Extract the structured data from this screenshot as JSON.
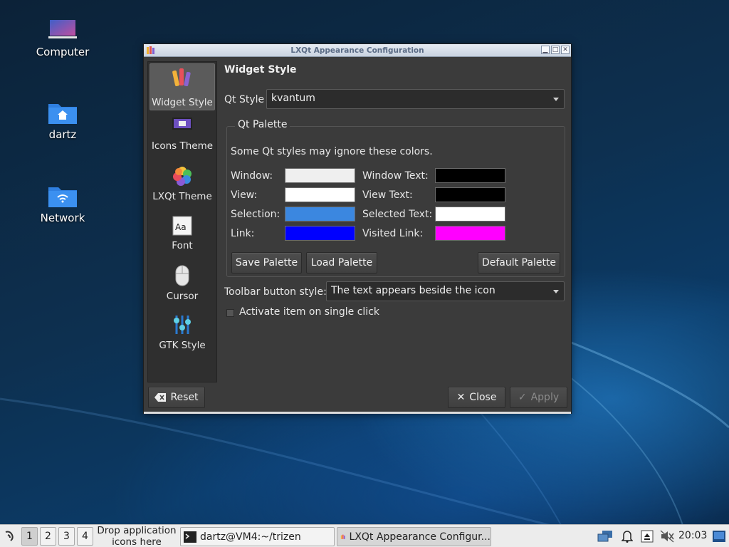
{
  "desktop": {
    "icons": [
      {
        "label": "Computer"
      },
      {
        "label": "dartz"
      },
      {
        "label": "Network"
      }
    ]
  },
  "window": {
    "title": "LXQt Appearance Configuration",
    "sidebar": {
      "items": [
        {
          "label": "Widget Style",
          "icon": "widget-style-icon",
          "active": true
        },
        {
          "label": "Icons Theme",
          "icon": "icons-theme-icon"
        },
        {
          "label": "LXQt Theme",
          "icon": "lxqt-theme-icon"
        },
        {
          "label": "Font",
          "icon": "font-icon"
        },
        {
          "label": "Cursor",
          "icon": "cursor-icon"
        },
        {
          "label": "GTK Style",
          "icon": "gtk-style-icon"
        }
      ]
    },
    "page": {
      "heading": "Widget Style",
      "qt_style_label": "Qt Style",
      "qt_style_value": "kvantum",
      "palette": {
        "group_title": "Qt Palette",
        "note": "Some Qt styles may ignore these colors.",
        "rows": [
          {
            "left_label": "Window:",
            "left_color": "#efefef",
            "right_label": "Window Text:",
            "right_color": "#000000"
          },
          {
            "left_label": "View:",
            "left_color": "#ffffff",
            "right_label": "View Text:",
            "right_color": "#000000"
          },
          {
            "left_label": "Selection:",
            "left_color": "#3b87e0",
            "right_label": "Selected Text:",
            "right_color": "#ffffff"
          },
          {
            "left_label": "Link:",
            "left_color": "#0000ff",
            "right_label": "Visited Link:",
            "right_color": "#ff00ff"
          }
        ],
        "save_button": "Save Palette",
        "load_button": "Load Palette",
        "default_button": "Default Palette"
      },
      "toolbar_style_label": "Toolbar button style:",
      "toolbar_style_value": "The text appears beside the icon",
      "single_click_label": "Activate item on single click",
      "single_click_checked": false
    },
    "buttons": {
      "reset": "Reset",
      "close": "Close",
      "apply": "Apply"
    }
  },
  "taskbar": {
    "workspaces": [
      "1",
      "2",
      "3",
      "4"
    ],
    "active_workspace": "1",
    "drop_hint_line1": "Drop application",
    "drop_hint_line2": "icons here",
    "tasks": [
      {
        "label": "dartz@VM4:~/trizen",
        "icon": "terminal-icon"
      },
      {
        "label": "LXQt Appearance Configur...",
        "icon": "appearance-icon",
        "active": true
      }
    ],
    "clock": "20:03"
  }
}
